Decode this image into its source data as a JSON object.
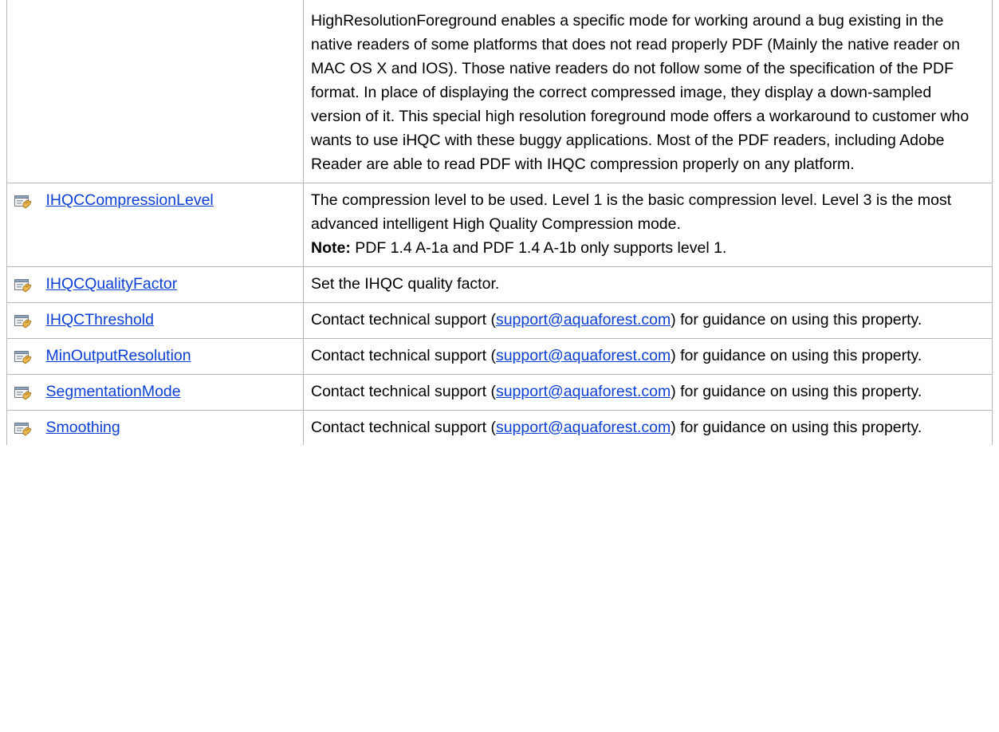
{
  "colors": {
    "link": "#0b3fd6",
    "border": "#b7b7b7"
  },
  "rows": [
    {
      "name": "",
      "description": "HighResolutionForeground enables a specific mode for working around a bug existing in the native readers of some platforms that does not read properly PDF (Mainly the native reader on MAC OS X and IOS). Those native readers do not follow some of the specification of the PDF format. In place of displaying the correct compressed image, they display a down-sampled version of it. This special high resolution foreground mode offers a workaround to customer who wants to use iHQC with these buggy applications. Most of the PDF readers, including Adobe Reader are able to read PDF with IHQC compression properly on any platform."
    },
    {
      "icon": "property-icon",
      "name": "IHQCCompressionLevel",
      "description": "The compression level to be used. Level 1 is the basic compression level. Level 3 is the most advanced intelligent High Quality Compression mode.",
      "note_label": "Note:",
      "note_text": " PDF 1.4 A-1a and PDF 1.4 A-1b only supports level 1."
    },
    {
      "icon": "property-icon",
      "name": "IHQCQualityFactor",
      "description": "Set the IHQC quality factor."
    },
    {
      "icon": "property-icon",
      "name": "IHQCThreshold",
      "desc_before": "Contact technical support (",
      "email": "support@aquaforest.com",
      "desc_after": ") for guidance on using this property."
    },
    {
      "icon": "property-icon",
      "name": "MinOutputResolution",
      "desc_before": "Contact technical support (",
      "email": "support@aquaforest.com",
      "desc_after": ") for guidance on using this property."
    },
    {
      "icon": "property-icon",
      "name": "SegmentationMode",
      "desc_before": "Contact technical support (",
      "email": "support@aquaforest.com",
      "desc_after": ") for guidance on using this property."
    },
    {
      "icon": "property-icon",
      "name": "Smoothing",
      "desc_before": "Contact technical support (",
      "email": "support@aquaforest.com",
      "desc_after": ") for guidance on using this property."
    }
  ]
}
